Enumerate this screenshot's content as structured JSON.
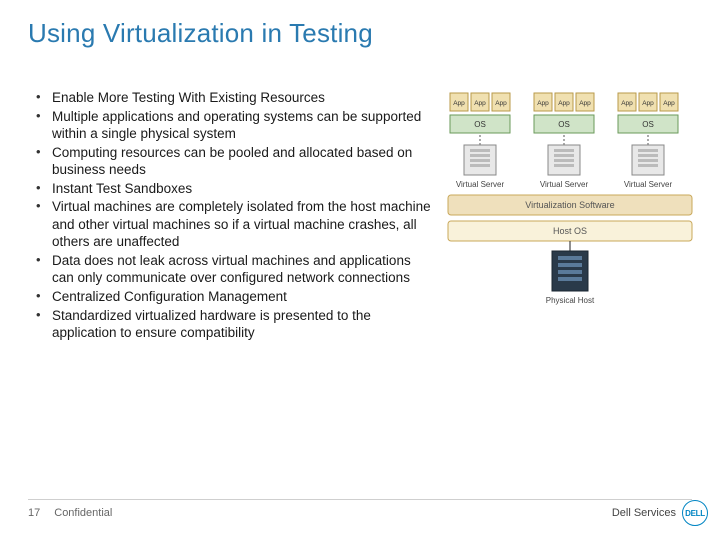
{
  "title": "Using Virtualization in Testing",
  "bullets": [
    "Enable More Testing With Existing Resources",
    "Multiple applications and operating systems can be supported within a single physical system",
    "Computing resources can be pooled and allocated based on business needs",
    "Instant Test Sandboxes",
    "Virtual machines are completely isolated from the host machine and other virtual machines so if a virtual machine crashes, all others are unaffected",
    "Data does not leak across virtual machines and applications can only communicate over configured network connections",
    "Centralized Configuration Management",
    "Standardized virtualized hardware is presented to the application to ensure compatibility"
  ],
  "diagram": {
    "app_label": "App",
    "os_label": "OS",
    "virtual_server_label": "Virtual Server",
    "virtualization_software_label": "Virtualization Software",
    "host_os_label": "Host OS",
    "physical_host_label": "Physical Host"
  },
  "footer": {
    "page_number": "17",
    "confidential": "Confidential",
    "brand": "Dell Services",
    "logo_text": "DELL"
  }
}
